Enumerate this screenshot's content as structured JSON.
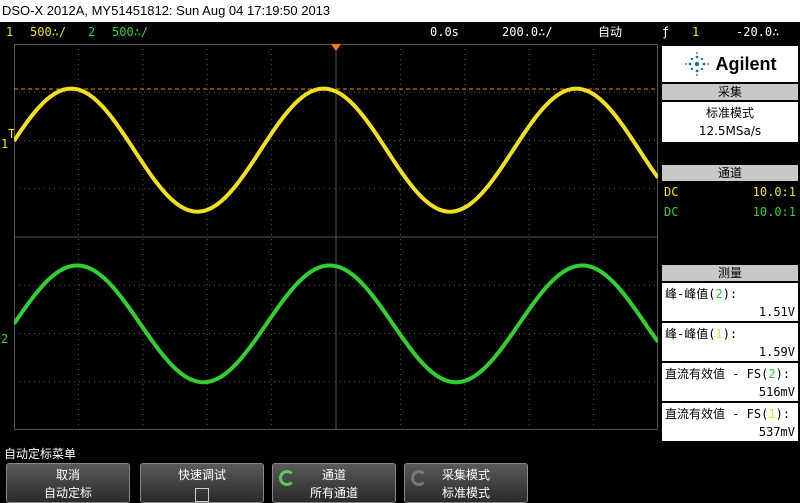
{
  "title": "DSO-X 2012A, MY51451812: Sun Aug 04 17:19:50 2013",
  "status": {
    "ch1_num": "1",
    "ch1_scale": "500∴/",
    "ch2_num": "2",
    "ch2_scale": "500∴/",
    "time_offset": "0.0s",
    "time_scale": "200.0∴/",
    "trigger_mode": "自动",
    "trigger_icon": "ƒ",
    "trigger_src": "1",
    "trigger_level": "-20.0∴"
  },
  "markers": {
    "trig_left": "T",
    "ch1": "1",
    "ch2": "2"
  },
  "colors": {
    "ch1": "#f0e020",
    "ch2": "#30d030",
    "trigger_marker": "#ff8000",
    "grid": "#555555"
  },
  "panel": {
    "brand": "Agilent",
    "acquire_head": "采集",
    "acquire_mode": "标准模式",
    "sample_rate": "12.5MSa/s",
    "channel_head": "通道",
    "channels": [
      {
        "coupling": "DC",
        "probe": "10.0:1"
      },
      {
        "coupling": "DC",
        "probe": "10.0:1"
      }
    ],
    "measure_head": "测量",
    "measurements": [
      {
        "label_pre": "峰-峰值(",
        "src": "2",
        "label_post": "):",
        "value": "1.51V"
      },
      {
        "label_pre": "峰-峰值(",
        "src": "1",
        "label_post": "):",
        "value": "1.59V"
      },
      {
        "label_pre": "直流有效值 - FS(",
        "src": "2",
        "label_post": "):",
        "value": "516mV"
      },
      {
        "label_pre": "直流有效值 - FS(",
        "src": "1",
        "label_post": "):",
        "value": "537mV"
      }
    ]
  },
  "menu_title": "自动定标菜单",
  "softkeys": [
    {
      "line1": "取消",
      "line2": "自动定标"
    },
    {
      "line1": "快速调试",
      "line2": ""
    },
    {
      "line1": "通道",
      "line2": "所有通道"
    },
    {
      "line1": "采集模式",
      "line2": "标准模式"
    }
  ],
  "waveform": {
    "cycles_visible": 2.55,
    "ch1_pp_divs": 2.55,
    "ch2_pp_divs": 2.42
  }
}
